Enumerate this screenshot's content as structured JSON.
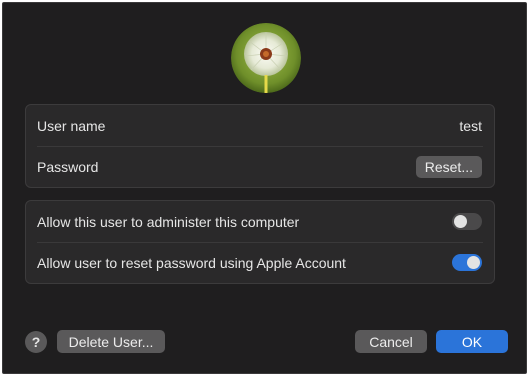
{
  "account": {
    "avatar_icon": "dandelion-avatar-icon",
    "username_label": "User name",
    "username_value": "test",
    "password_label": "Password",
    "reset_button": "Reset..."
  },
  "permissions": {
    "admin_label": "Allow this user to administer this computer",
    "admin_enabled": false,
    "reset_label": "Allow user to reset password using Apple Account",
    "reset_enabled": true
  },
  "footer": {
    "help_label": "?",
    "delete_button": "Delete User...",
    "cancel_button": "Cancel",
    "ok_button": "OK"
  },
  "colors": {
    "accent": "#2b74d9",
    "background": "#1f1e1f",
    "card": "#2a292a"
  }
}
